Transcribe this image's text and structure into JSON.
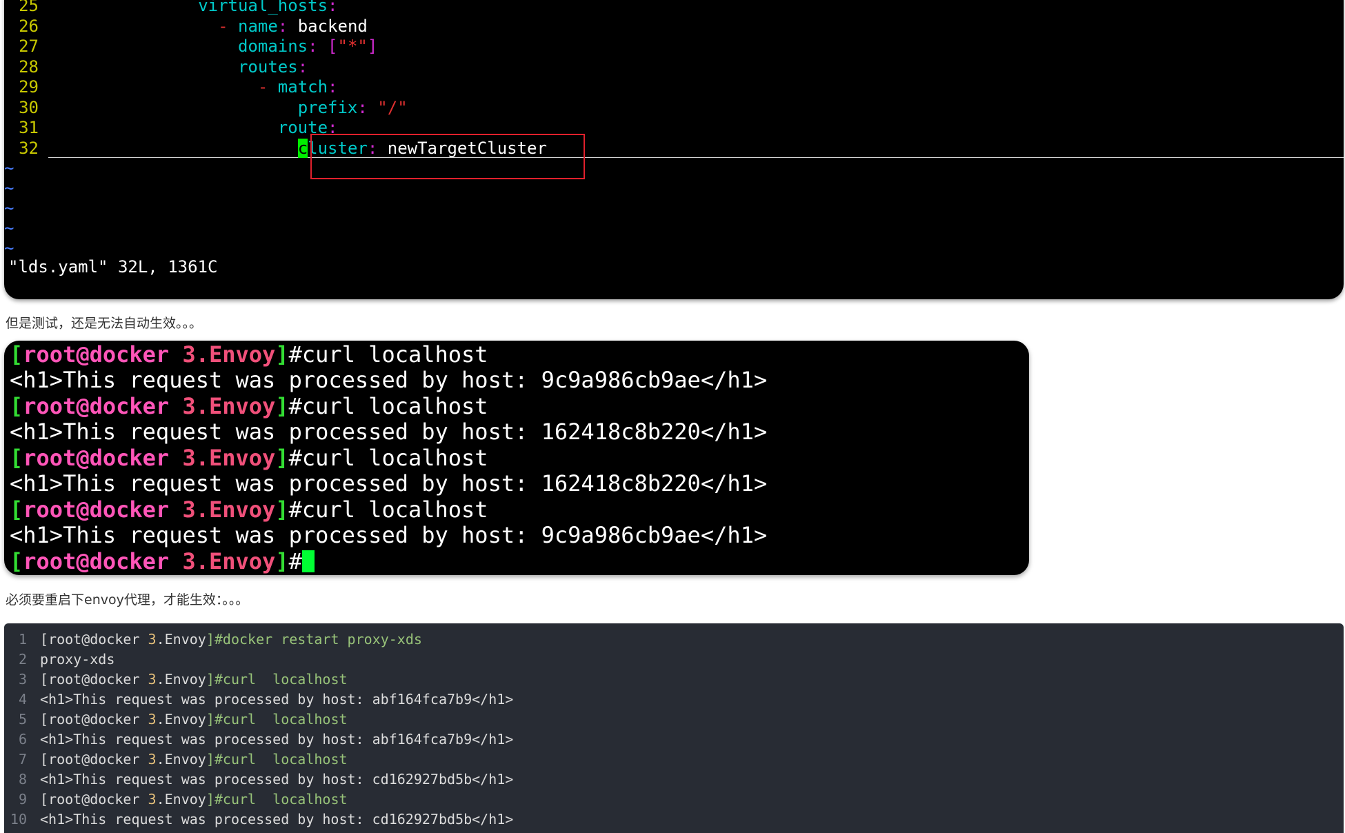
{
  "vim": {
    "lines": [
      {
        "n": "25",
        "indent": "                ",
        "key": "virtual_hosts",
        "colon": ":"
      },
      {
        "n": "26",
        "indent": "                  ",
        "dash": "- ",
        "key": "name",
        "colon": ": ",
        "val": "backend"
      },
      {
        "n": "27",
        "indent": "                    ",
        "key": "domains",
        "colon": ": ",
        "val_punct_open": "[",
        "val_str": "\"*\"",
        "val_punct_close": "]"
      },
      {
        "n": "28",
        "indent": "                    ",
        "key": "routes",
        "colon": ":"
      },
      {
        "n": "29",
        "indent": "                      ",
        "dash": "- ",
        "key": "match",
        "colon": ":"
      },
      {
        "n": "30",
        "indent": "                          ",
        "key": "prefix",
        "colon": ": ",
        "val_str": "\"/\""
      },
      {
        "n": "31",
        "indent": "                        ",
        "key": "route",
        "colon": ":"
      },
      {
        "n": "32",
        "indent": "                          ",
        "cursor_char": "c",
        "key": "luster",
        "colon": ": ",
        "val": "newTargetCluster"
      }
    ],
    "tilde": "~",
    "status": "\"lds.yaml\" 32L, 1361C"
  },
  "captions": {
    "first": "但是测试，还是无法自动生效。。。",
    "second": "必须要重启下envoy代理，才能生效：。。。"
  },
  "terminal": {
    "prompt_open": "[",
    "prompt_user": "root@docker",
    "prompt_dir": " 3.Envoy",
    "prompt_close": "]",
    "rows": [
      {
        "cmd": "#curl localhost",
        "out": "<h1>This request was processed by host: 9c9a986cb9ae</h1>"
      },
      {
        "cmd": "#curl localhost",
        "out": "<h1>This request was processed by host: 162418c8b220</h1>"
      },
      {
        "cmd": "#curl localhost",
        "out": "<h1>This request was processed by host: 162418c8b220</h1>"
      },
      {
        "cmd": "#curl localhost",
        "out": "<h1>This request was processed by host: 9c9a986cb9ae</h1>"
      }
    ],
    "final_cmd": "#"
  },
  "code": {
    "lines": [
      {
        "n": "1",
        "a": "[root@docker ",
        "b": "3",
        "c": ".Envoy",
        "d": "]#docker restart proxy-xds"
      },
      {
        "n": "2",
        "plain": "proxy-xds"
      },
      {
        "n": "3",
        "a": "[root@docker ",
        "b": "3",
        "c": ".Envoy",
        "d": "]#curl  localhost"
      },
      {
        "n": "4",
        "plain": "<h1>This request was processed by host: abf164fca7b9</h1>"
      },
      {
        "n": "5",
        "a": "[root@docker ",
        "b": "3",
        "c": ".Envoy",
        "d": "]#curl  localhost"
      },
      {
        "n": "6",
        "plain": "<h1>This request was processed by host: abf164fca7b9</h1>"
      },
      {
        "n": "7",
        "a": "[root@docker ",
        "b": "3",
        "c": ".Envoy",
        "d": "]#curl  localhost"
      },
      {
        "n": "8",
        "plain": "<h1>This request was processed by host: cd162927bd5b</h1>"
      },
      {
        "n": "9",
        "a": "[root@docker ",
        "b": "3",
        "c": ".Envoy",
        "d": "]#curl  localhost"
      },
      {
        "n": "10",
        "plain": "<h1>This request was processed by host: cd162927bd5b</h1>"
      }
    ]
  }
}
